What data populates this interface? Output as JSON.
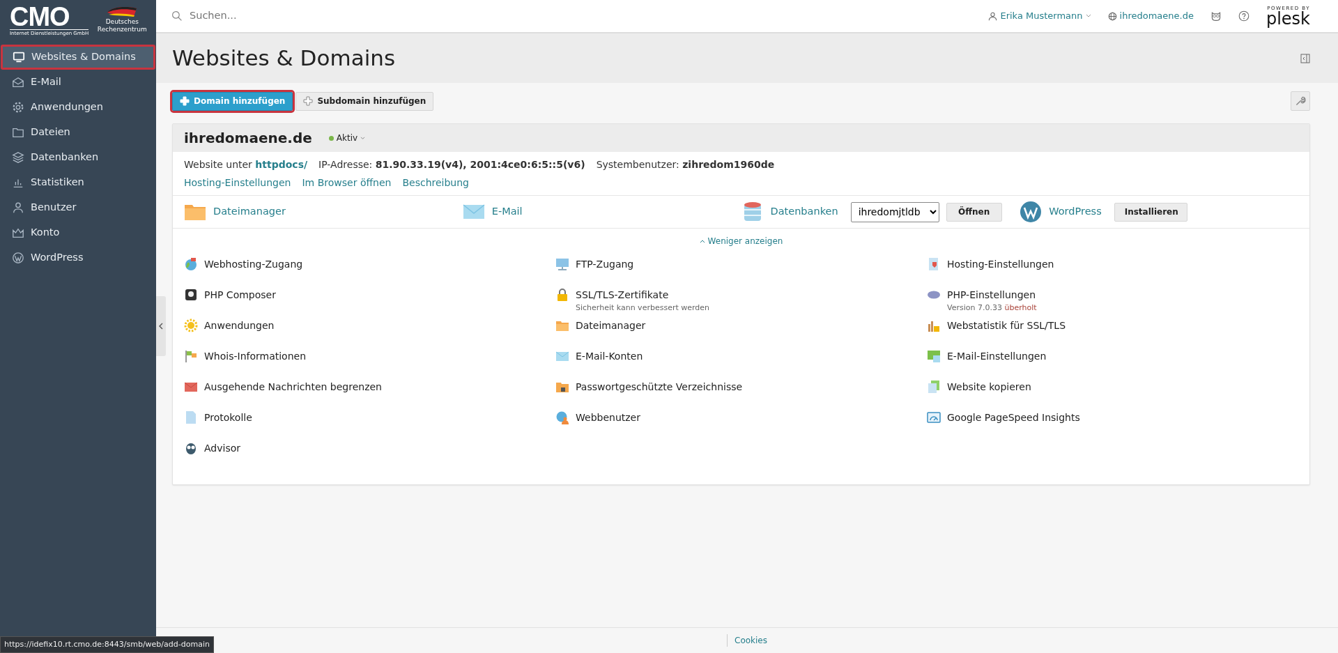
{
  "sidebar": {
    "logo": {
      "brand": "CMO",
      "tagline": "Internet Dienstleistungen GmbH",
      "partner": "Deutsches Rechenzentrum"
    },
    "items": [
      {
        "label": "Websites & Domains",
        "selected": true
      },
      {
        "label": "E-Mail",
        "selected": false
      },
      {
        "label": "Anwendungen",
        "selected": false
      },
      {
        "label": "Dateien",
        "selected": false
      },
      {
        "label": "Datenbanken",
        "selected": false
      },
      {
        "label": "Statistiken",
        "selected": false
      },
      {
        "label": "Benutzer",
        "selected": false
      },
      {
        "label": "Konto",
        "selected": false
      },
      {
        "label": "WordPress",
        "selected": false
      }
    ]
  },
  "topbar": {
    "search": {
      "placeholder": "Suchen..."
    },
    "user": "Erika Mustermann",
    "domain": "ihredomaene.de",
    "brand": {
      "overline": "POWERED BY",
      "name": "plesk"
    }
  },
  "page": {
    "title": "Websites & Domains"
  },
  "toolbar": {
    "buttons": [
      {
        "label": "Domain hinzufügen",
        "kind": "primary",
        "highlighted": true
      },
      {
        "label": "Subdomain hinzufügen",
        "kind": "secondary",
        "highlighted": false
      }
    ]
  },
  "domain": {
    "name": "ihredomaene.de",
    "status": "Aktiv",
    "active": true,
    "info": [
      {
        "label": "Website unter",
        "value": "httpdocs/",
        "kind": "link"
      },
      {
        "label": "IP-Adresse:",
        "value": "81.90.33.19(v4), 2001:4ce0:6:5::5(v6)",
        "kind": "text"
      },
      {
        "label": "Systembenutzer:",
        "value": "zihredom1960de",
        "kind": "text"
      }
    ],
    "links": [
      "Hosting-Einstellungen",
      "Im Browser öffnen",
      "Beschreibung"
    ],
    "quick": [
      {
        "label": "Dateimanager",
        "kind": "plain"
      },
      {
        "label": "E-Mail",
        "kind": "plain"
      },
      {
        "label": "Datenbanken",
        "kind": "select",
        "value": "ihredomjtldb",
        "button": "Öffnen"
      },
      {
        "label": "WordPress",
        "kind": "button",
        "button": "Installieren"
      }
    ],
    "toggle": "Weniger anzeigen",
    "tools": [
      {
        "label": "Webhosting-Zugang"
      },
      {
        "label": "FTP-Zugang"
      },
      {
        "label": "Hosting-Einstellungen"
      },
      {
        "label": "PHP Composer"
      },
      {
        "label": "SSL/TLS-Zertifikate",
        "note": "Sicherheit kann verbessert werden"
      },
      {
        "label": "PHP-Einstellungen",
        "note": "Version 7.0.33",
        "warning": "überholt"
      },
      {
        "label": "Anwendungen"
      },
      {
        "label": "Dateimanager"
      },
      {
        "label": "Webstatistik für SSL/TLS"
      },
      {
        "label": "Whois-Informationen"
      },
      {
        "label": "E-Mail-Konten"
      },
      {
        "label": "E-Mail-Einstellungen"
      },
      {
        "label": "Ausgehende Nachrichten begrenzen"
      },
      {
        "label": "Passwortgeschützte Verzeichnisse"
      },
      {
        "label": "Website kopieren"
      },
      {
        "label": "Protokolle"
      },
      {
        "label": "Webbenutzer"
      },
      {
        "label": "Google PageSpeed Insights"
      },
      {
        "label": "Advisor"
      }
    ]
  },
  "footer": {
    "link": "Cookies"
  },
  "status_url": "https://idefix10.rt.cmo.de:8443/smb/web/add-domain"
}
